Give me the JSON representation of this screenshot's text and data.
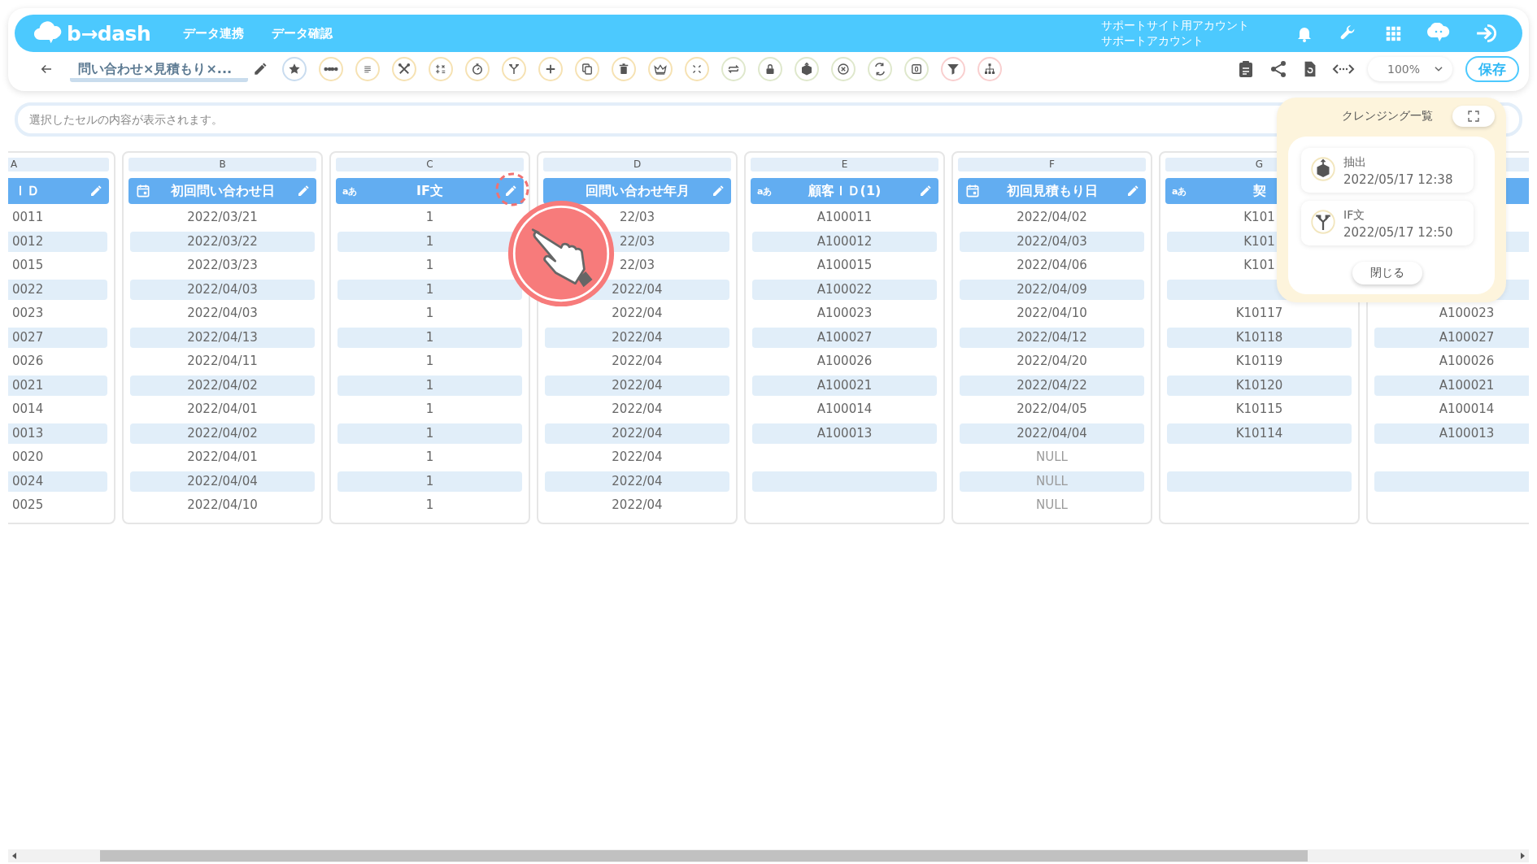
{
  "header": {
    "logo": "b→dash",
    "nav": [
      "データ連携",
      "データ確認"
    ],
    "account": [
      "サポートサイト用アカウント",
      "サポートアカウント"
    ]
  },
  "toolbar": {
    "title": "問い合わせ×見積もり×...",
    "tools": [
      {
        "kind": "star",
        "color": "#c9dcef"
      },
      {
        "kind": "dots",
        "color": "#f6e2b3"
      },
      {
        "kind": "lines",
        "color": "#f6e2b3"
      },
      {
        "kind": "scissors",
        "color": "#f6e2b3"
      },
      {
        "kind": "calc",
        "color": "#f6e2b3"
      },
      {
        "kind": "timer",
        "color": "#f6e2b3"
      },
      {
        "kind": "branch",
        "color": "#f6e2b3"
      },
      {
        "kind": "plus",
        "color": "#f6e2b3"
      },
      {
        "kind": "copy",
        "color": "#f6e2b3"
      },
      {
        "kind": "trash",
        "color": "#f6e2b3"
      },
      {
        "kind": "crown",
        "color": "#f6e2b3"
      },
      {
        "kind": "compress",
        "color": "#f6e2b3"
      },
      {
        "kind": "swap",
        "color": "#dfe8cc"
      },
      {
        "kind": "lock",
        "color": "#dfe8cc"
      },
      {
        "kind": "box",
        "color": "#dfe8cc"
      },
      {
        "kind": "cancel",
        "color": "#dfe8cc"
      },
      {
        "kind": "translate",
        "color": "#dfe8cc"
      },
      {
        "kind": "square",
        "color": "#dfe8cc"
      },
      {
        "kind": "filter",
        "color": "#f9cfcf"
      },
      {
        "kind": "hierarchy",
        "color": "#f9cfcf"
      }
    ],
    "zoom": "100%",
    "save": "保存"
  },
  "formula_bar": {
    "placeholder": "選択したセルの内容が表示されます。"
  },
  "columns": [
    {
      "letter": "A",
      "name": "ＩＤ",
      "edit_button": true,
      "cells": [
        "0011",
        "0012",
        "0015",
        "0022",
        "0023",
        "0027",
        "0026",
        "0021",
        "0014",
        "0013",
        "0020",
        "0024",
        "0025"
      ]
    },
    {
      "letter": "B",
      "name": "初回問い合わせ日",
      "type": {
        "kind": "date"
      },
      "edit_button": true,
      "cells": [
        "2022/03/21",
        "2022/03/22",
        "2022/03/23",
        "2022/04/03",
        "2022/04/03",
        "2022/04/13",
        "2022/04/11",
        "2022/04/02",
        "2022/04/01",
        "2022/04/02",
        "2022/04/01",
        "2022/04/04",
        "2022/04/10"
      ]
    },
    {
      "letter": "C",
      "name": "IF文",
      "type": {
        "kind": "text",
        "label": "aあ"
      },
      "edit_button": true,
      "cells": [
        "1",
        "1",
        "1",
        "1",
        "1",
        "1",
        "1",
        "1",
        "1",
        "1",
        "1",
        "1",
        "1"
      ]
    },
    {
      "letter": "D",
      "name": "回問い合わせ年月",
      "edit_button": true,
      "cells": [
        "22/03",
        "22/03",
        "22/03",
        "2022/04",
        "2022/04",
        "2022/04",
        "2022/04",
        "2022/04",
        "2022/04",
        "2022/04",
        "2022/04",
        "2022/04",
        "2022/04"
      ]
    },
    {
      "letter": "E",
      "name": "顧客ＩＤ(1)",
      "type": {
        "kind": "text",
        "label": "aあ"
      },
      "edit_button": true,
      "cells": [
        "A100011",
        "A100012",
        "A100015",
        "A100022",
        "A100023",
        "A100027",
        "A100026",
        "A100021",
        "A100014",
        "A100013",
        null,
        null,
        null
      ]
    },
    {
      "letter": "F",
      "name": "初回見積もり日",
      "type": {
        "kind": "date"
      },
      "edit_button": true,
      "cells": [
        "2022/04/02",
        "2022/04/03",
        "2022/04/06",
        "2022/04/09",
        "2022/04/10",
        "2022/04/12",
        "2022/04/20",
        "2022/04/22",
        "2022/04/05",
        "2022/04/04",
        {
          "text": "NULL",
          "kind": "null"
        },
        {
          "text": "NULL",
          "kind": "null"
        },
        {
          "text": "NULL",
          "kind": "null"
        }
      ]
    },
    {
      "letter": "G",
      "name": "契",
      "type": {
        "kind": "text",
        "label": "aあ"
      },
      "edit_button": false,
      "cells": [
        "K101",
        "K101",
        "K101",
        null,
        "K10117",
        "K10118",
        "K10119",
        "K10120",
        "K10115",
        "K10114",
        null,
        null,
        null
      ]
    },
    {
      "edit_button": false,
      "cells": [
        null,
        null,
        null,
        null,
        "A100023",
        "A100027",
        "A100026",
        "A100021",
        "A100014",
        "A100013",
        null,
        null,
        null
      ]
    }
  ],
  "cleansing_panel": {
    "title": "クレンジング一覧",
    "items": [
      {
        "kind": "extract",
        "name": "抽出",
        "time": "2022/05/17 12:38"
      },
      {
        "kind": "branch",
        "name": "IF文",
        "time": "2022/05/17 12:50"
      }
    ],
    "close": "閉じる"
  }
}
